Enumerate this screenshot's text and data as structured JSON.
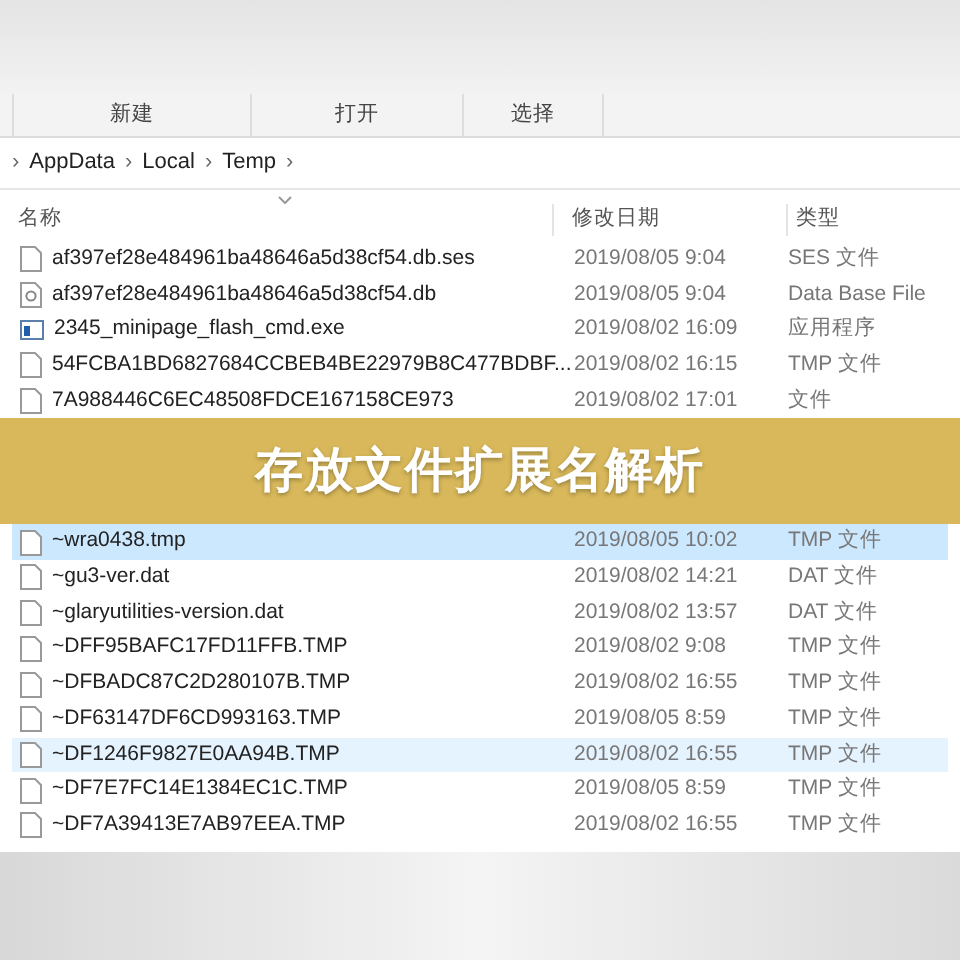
{
  "toolbar": {
    "buttons": [
      "新建",
      "打开",
      "选择"
    ]
  },
  "breadcrumb": {
    "separator": "›",
    "parts": [
      "AppData",
      "Local",
      "Temp"
    ]
  },
  "columns": [
    "名称",
    "修改日期",
    "类型"
  ],
  "rows": [
    {
      "kind": "file",
      "name": "af397ef28e484961ba48646a5d38cf54.db.ses",
      "date": "2019/08/05 9:04",
      "type": "SES 文件",
      "selected": false,
      "hovered": false
    },
    {
      "kind": "db",
      "name": "af397ef28e484961ba48646a5d38cf54.db",
      "date": "2019/08/05 9:04",
      "type": "Data Base File",
      "selected": false,
      "hovered": false
    },
    {
      "kind": "exe",
      "name": "2345_minipage_flash_cmd.exe",
      "date": "2019/08/02 16:09",
      "type": "应用程序",
      "selected": false,
      "hovered": false
    },
    {
      "kind": "file",
      "name": "54FCBA1BD6827684CCBEB4BE22979B8C477BDBF...",
      "date": "2019/08/02 16:15",
      "type": "TMP 文件",
      "selected": false,
      "hovered": false
    },
    {
      "kind": "file",
      "name": "7A988446C6EC48508FDCE167158CE973",
      "date": "2019/08/02 17:01",
      "type": "文件",
      "selected": false,
      "hovered": false
    },
    {
      "kind": "banner",
      "title": "存放文件扩展名解析"
    },
    {
      "kind": "file",
      "name": "~wra0438.tmp",
      "date": "2019/08/05 10:02",
      "type": "TMP 文件",
      "selected": true,
      "hovered": false
    },
    {
      "kind": "file",
      "name": "~gu3-ver.dat",
      "date": "2019/08/02 14:21",
      "type": "DAT 文件",
      "selected": false,
      "hovered": false
    },
    {
      "kind": "file",
      "name": "~glaryutilities-version.dat",
      "date": "2019/08/02 13:57",
      "type": "DAT 文件",
      "selected": false,
      "hovered": false
    },
    {
      "kind": "file",
      "name": "~DFF95BAFC17FD11FFB.TMP",
      "date": "2019/08/02 9:08",
      "type": "TMP 文件",
      "selected": false,
      "hovered": false
    },
    {
      "kind": "file",
      "name": "~DFBADC87C2D280107B.TMP",
      "date": "2019/08/02 16:55",
      "type": "TMP 文件",
      "selected": false,
      "hovered": false
    },
    {
      "kind": "file",
      "name": "~DF63147DF6CD993163.TMP",
      "date": "2019/08/05 8:59",
      "type": "TMP 文件",
      "selected": false,
      "hovered": false
    },
    {
      "kind": "file",
      "name": "~DF1246F9827E0AA94B.TMP",
      "date": "2019/08/02 16:55",
      "type": "TMP 文件",
      "selected": false,
      "hovered": true
    },
    {
      "kind": "file",
      "name": "~DF7E7FC14E1384EC1C.TMP",
      "date": "2019/08/05 8:59",
      "type": "TMP 文件",
      "selected": false,
      "hovered": false
    },
    {
      "kind": "file",
      "name": "~DF7A39413E7AB97EEA.TMP",
      "date": "2019/08/02 16:55",
      "type": "TMP 文件",
      "selected": false,
      "hovered": false
    }
  ]
}
